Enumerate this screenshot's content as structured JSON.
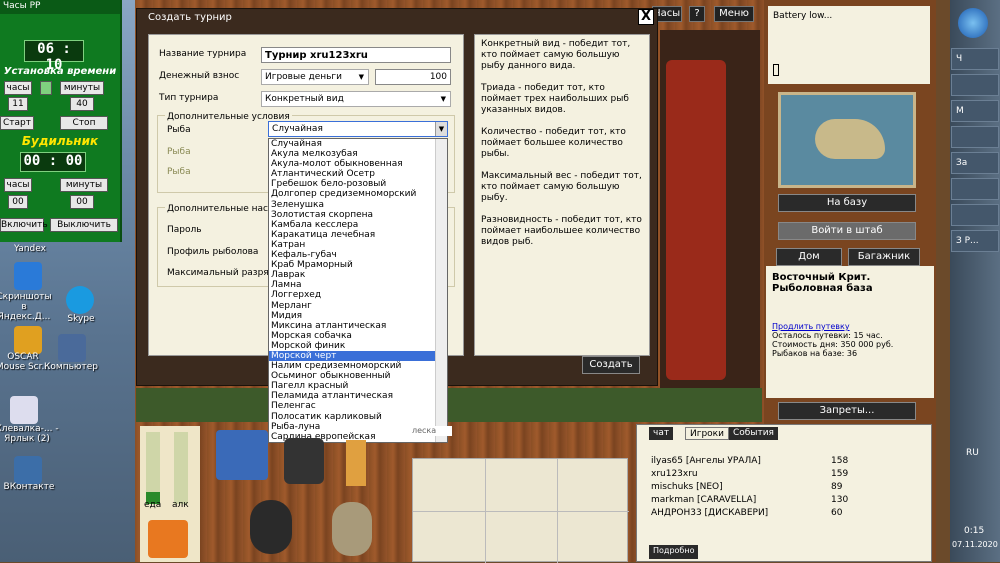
{
  "timer": {
    "title": "Часы PP",
    "time": "06 : 10",
    "set_time": "Установка времени",
    "hours_label": "часы",
    "minutes_label": "минуты",
    "hours_val": "11",
    "minutes_val": "40",
    "start": "Старт",
    "stop": "Стоп",
    "alarm": "Будильник",
    "alarm_time": "00 : 00",
    "alarm_hours": "00",
    "alarm_minutes": "00",
    "on": "Включить",
    "off": "Выключить"
  },
  "desktop": [
    {
      "label": "Yandex"
    },
    {
      "label": "Скриншоты в Яндекс.Д..."
    },
    {
      "label": "Skype"
    },
    {
      "label": "OSCAR Mouse Scr..."
    },
    {
      "label": "Компьютер"
    },
    {
      "label": "Клевалка-... - Ярлык (2)"
    },
    {
      "label": "ВКонтакте"
    }
  ],
  "dialog": {
    "title": "Создать турнир",
    "close": "X",
    "create": "Создать",
    "form": {
      "name_label": "Название турнира",
      "name_value": "Турнир xru123xru",
      "fee_label": "Денежный взнос",
      "fee_type": "Игровые деньги",
      "fee_amount": "100",
      "type_label": "Тип турнира",
      "type_value": "Конкретный вид",
      "extra_label": "Дополнительные условия",
      "fish_label": "Рыба",
      "fish_value": "Случайная",
      "fish2": "Рыба",
      "fish3": "Рыба",
      "extra2_label": "Дополнительные наст...",
      "password": "Пароль",
      "profile": "Профиль рыболова",
      "maxrank": "Максимальный разряд"
    },
    "help": [
      "Конкретный вид - победит тот, кто поймает самую большую рыбу данного вида.",
      "Триада - победит тот, кто поймает трех наибольших рыб указанных видов.",
      "Количество - победит тот, кто поймает большее количество рыбы.",
      "Максимальный вес - победит тот, кто поймает самую большую рыбу.",
      "Разновидность - победит тот, кто поймает наибольшее количество видов рыб."
    ]
  },
  "fish_options": [
    "Случайная",
    "Акула мелкозубая",
    "Акула-молот обыкновенная",
    "Атлантический Осетр",
    "Гребешок бело-розовый",
    "Долгопер средиземноморский",
    "Зеленушка",
    "Золотистая скорпена",
    "Камбала кесслера",
    "Каракатица лечебная",
    "Катран",
    "Кефаль-губач",
    "Краб Мраморный",
    "Лаврак",
    "Ламна",
    "Логгерхед",
    "Мерланг",
    "Мидия",
    "Миксина атлантическая",
    "Морская собачка",
    "Морской финик",
    "Морской черт",
    "Налим средиземноморский",
    "Осьминог обыкновенный",
    "Пагелл красный",
    "Пеламида атлантическая",
    "Пеленгас",
    "Полосатик карликовый",
    "Рыба-луна",
    "Сардина европейская"
  ],
  "highlighted_fish": "Морской черт",
  "top": {
    "clock": "Часы",
    "help": "?",
    "menu": "Меню"
  },
  "right": {
    "battery": "Battery low...",
    "to_base": "На базу",
    "to_hq": "Войти в штаб",
    "home": "Дом",
    "trunk": "Багажник",
    "place_title": "Восточный Крит. Рыболовная база",
    "extend": "Продлить путевку",
    "left": "Осталось путевки: 15 час.",
    "cost": "Стоимость дня: 350 000 руб.",
    "fishers": "Рыбаков на базе: 36",
    "bans": "Запреты..."
  },
  "bottom": {
    "food": "еда",
    "alc": "алк",
    "lesk": "леска"
  },
  "chat": {
    "tabs": [
      "чат",
      "Игроки",
      "События"
    ],
    "players": [
      {
        "name": "ilyas65 [Ангелы УРАЛА]",
        "score": "158"
      },
      {
        "name": "xru123xru",
        "score": "159"
      },
      {
        "name": "mischuks [NEO]",
        "score": "89"
      },
      {
        "name": "markman [CARAVELLA]",
        "score": "130"
      },
      {
        "name": "АНДРОН33 [ДИСКАВЕРИ]",
        "score": "60"
      }
    ],
    "more": "Подробно"
  },
  "taskbar": {
    "items": [
      "Ч",
      "",
      "М",
      "",
      "За",
      "",
      "",
      "З Р..."
    ],
    "lang": "RU",
    "time": "0:15",
    "date": "07.11.2020"
  },
  "colors": {
    "highlight": "#3a6fd8",
    "panel": "#f4f1e0",
    "dark": "#2a2a2a"
  }
}
